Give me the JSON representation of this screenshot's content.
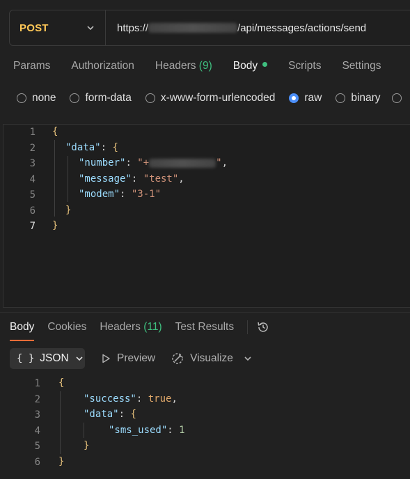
{
  "request": {
    "method": "POST",
    "url_prefix": "https://",
    "url_suffix": "/api/messages/actions/send"
  },
  "request_tabs": [
    {
      "label": "Params"
    },
    {
      "label": "Authorization"
    },
    {
      "label": "Headers",
      "count": "(9)"
    },
    {
      "label": "Body"
    },
    {
      "label": "Scripts"
    },
    {
      "label": "Settings"
    }
  ],
  "body_types": [
    "none",
    "form-data",
    "x-www-form-urlencoded",
    "raw",
    "binary"
  ],
  "body_type_selected": "raw",
  "request_body": {
    "line_numbers": [
      "1",
      "2",
      "3",
      "4",
      "5",
      "6",
      "7"
    ],
    "open_brace": "{",
    "close_brace": "}",
    "data_key": "\"data\"",
    "number_key": "\"number\"",
    "number_value_prefix": "\"+",
    "number_value_suffix": "\"",
    "message_key": "\"message\"",
    "message_value": "\"test\"",
    "modem_key": "\"modem\"",
    "modem_value": "\"3-1\""
  },
  "response_tabs": [
    {
      "label": "Body"
    },
    {
      "label": "Cookies"
    },
    {
      "label": "Headers",
      "count": "(11)"
    },
    {
      "label": "Test Results"
    }
  ],
  "response_toolbar": {
    "format_icon": "{ }",
    "format_label": "JSON",
    "preview_label": "Preview",
    "visualize_label": "Visualize"
  },
  "response_body": {
    "line_numbers": [
      "1",
      "2",
      "3",
      "4",
      "5",
      "6"
    ],
    "success_key": "\"success\"",
    "success_value": "true",
    "data_key": "\"data\"",
    "sms_used_key": "\"sms_used\"",
    "sms_used_value": "1"
  },
  "colors": {
    "method": "#ffc857",
    "accent_active_tab": "#ff6c37",
    "count_green": "#3fbf7f",
    "radio_selected": "#4b8ef7"
  }
}
